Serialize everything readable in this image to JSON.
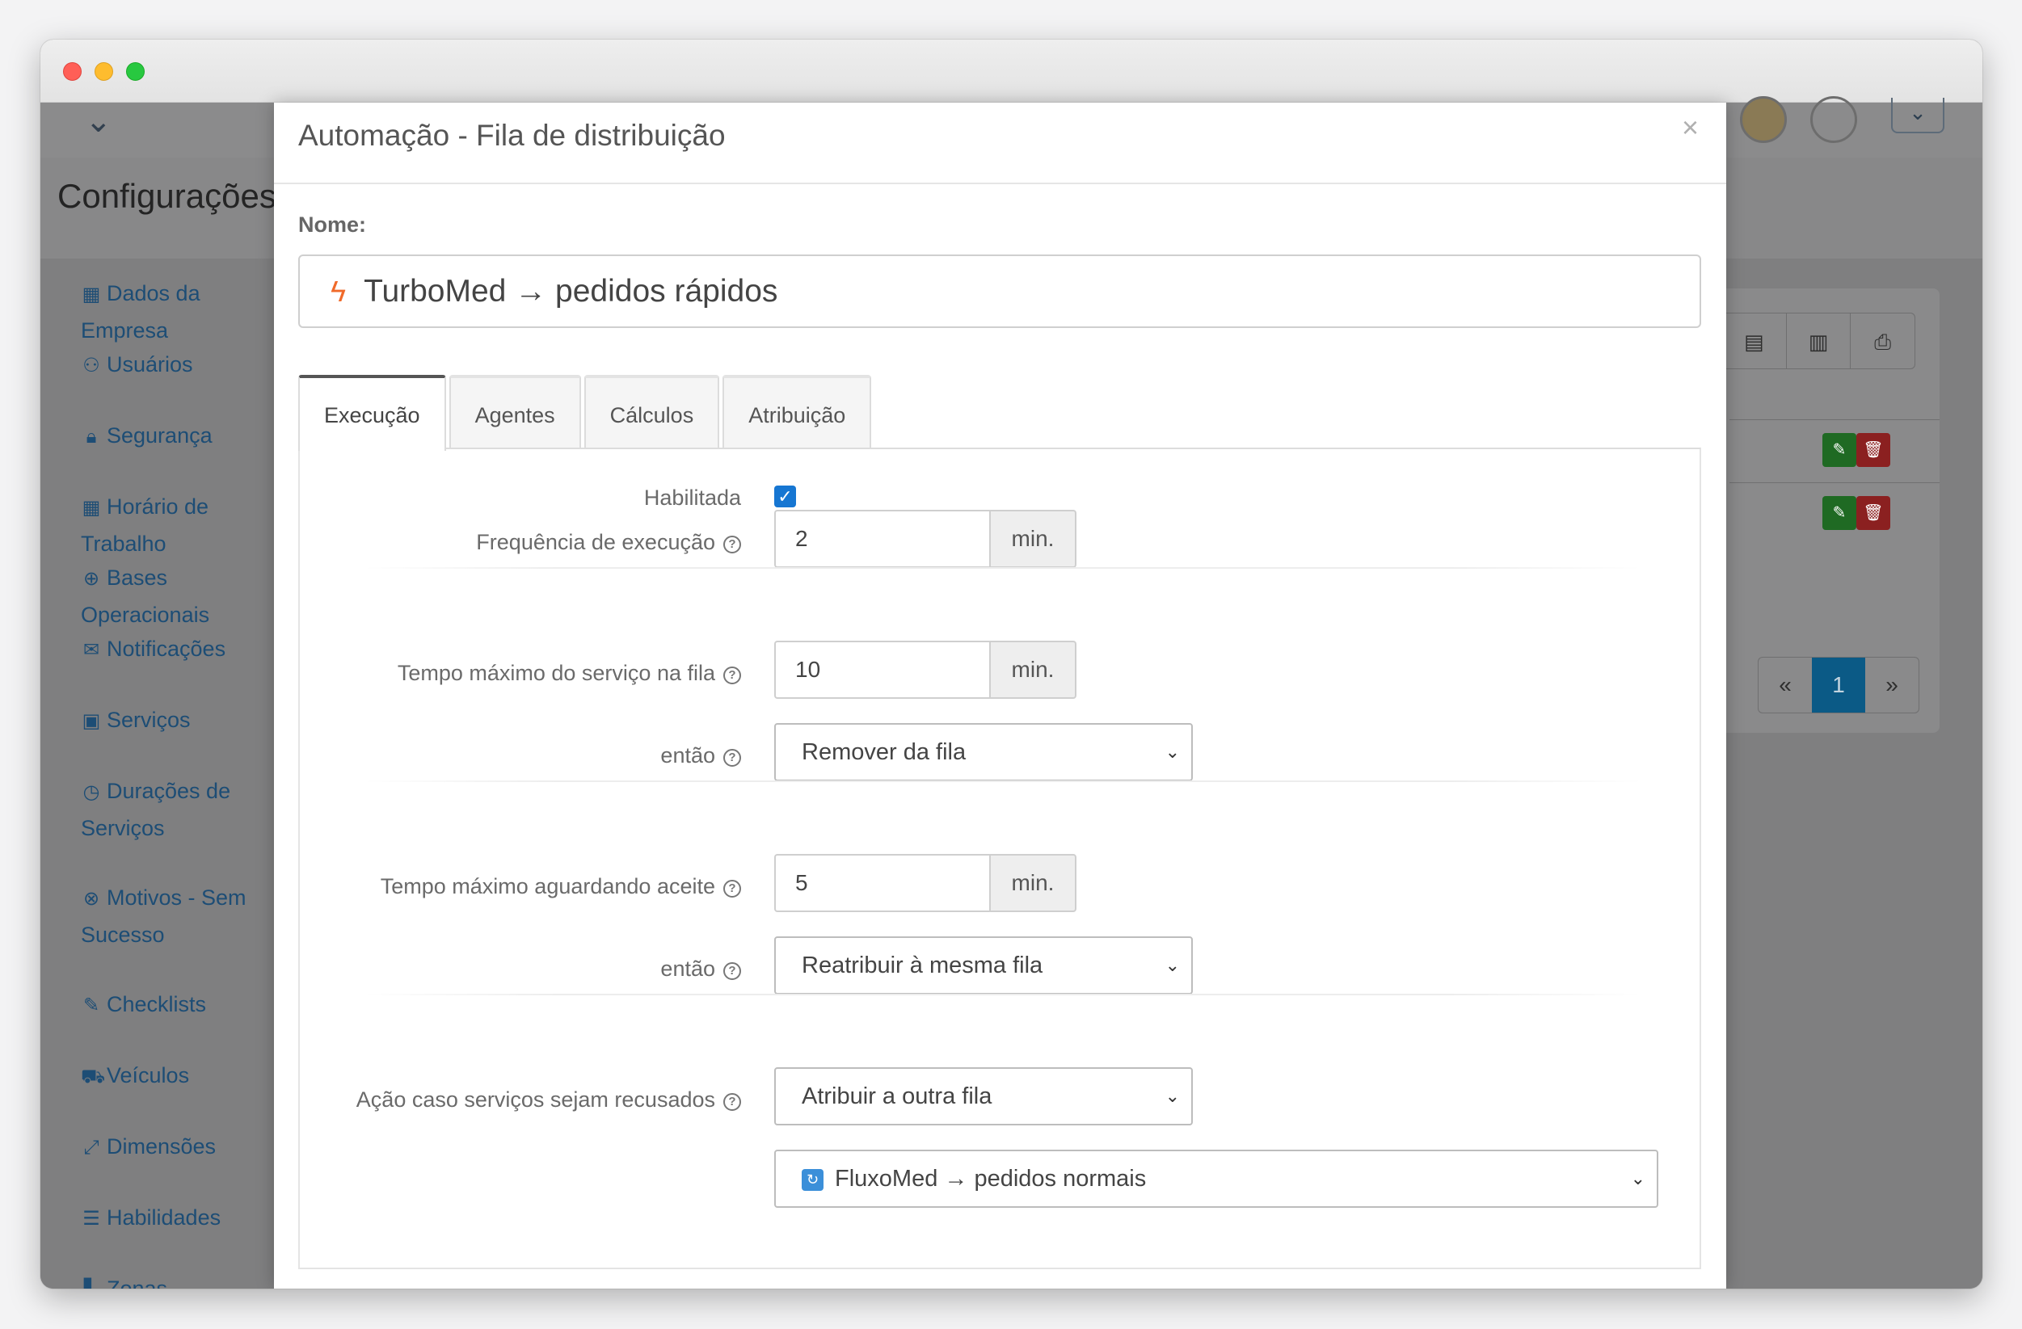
{
  "app": {
    "page_title": "Configurações",
    "sidebar": [
      {
        "icon": "building-icon",
        "glyph": "▦",
        "label": "Dados da Empresa"
      },
      {
        "icon": "users-icon",
        "glyph": "⚇",
        "label": "Usuários"
      },
      {
        "icon": "lock-icon",
        "glyph": "🔒︎",
        "label": "Segurança"
      },
      {
        "icon": "calendar-icon",
        "glyph": "▦",
        "label": "Horário de Trabalho"
      },
      {
        "icon": "globe-icon",
        "glyph": "⊕",
        "label": "Bases Operacionais"
      },
      {
        "icon": "envelope-icon",
        "glyph": "✉",
        "label": "Notificações"
      },
      {
        "icon": "briefcase-icon",
        "glyph": "▣",
        "label": "Serviços"
      },
      {
        "icon": "clock-icon",
        "glyph": "◷",
        "label": "Durações de Serviços"
      },
      {
        "icon": "x-circle-icon",
        "glyph": "⊗",
        "label": "Motivos - Sem Sucesso"
      },
      {
        "icon": "edit-icon",
        "glyph": "✎",
        "label": "Checklists"
      },
      {
        "icon": "truck-icon",
        "glyph": "⛟",
        "label": "Veículos"
      },
      {
        "icon": "expand-icon",
        "glyph": "⤢",
        "label": "Dimensões"
      },
      {
        "icon": "list-icon",
        "glyph": "☰",
        "label": "Habilidades"
      },
      {
        "icon": "map-icon",
        "glyph": "▚",
        "label": "Zonas"
      }
    ],
    "pager": {
      "prev": "«",
      "current": "1",
      "next": "»"
    }
  },
  "modal": {
    "title": "Automação - Fila de distribuição",
    "close": "×",
    "name_label": "Nome:",
    "name_value": "TurboMed → pedidos rápidos",
    "tabs": [
      "Execução",
      "Agentes",
      "Cálculos",
      "Atribuição"
    ],
    "active_tab": "Execução",
    "fields": {
      "enabled_label": "Habilitada",
      "enabled": true,
      "frequency_label": "Frequência de execução",
      "frequency_value": "2",
      "max_service_label": "Tempo máximo do serviço na fila",
      "max_service_value": "10",
      "then1_label": "então",
      "then1_value": "Remover da fila",
      "max_accept_label": "Tempo máximo aguardando aceite",
      "max_accept_value": "5",
      "then2_label": "então",
      "then2_value": "Reatribuir à mesma fila",
      "refused_label": "Ação caso serviços sejam recusados",
      "refused_value": "Atribuir a outra fila",
      "target_queue_value": "FluxoMed → pedidos normais",
      "unit": "min."
    }
  }
}
